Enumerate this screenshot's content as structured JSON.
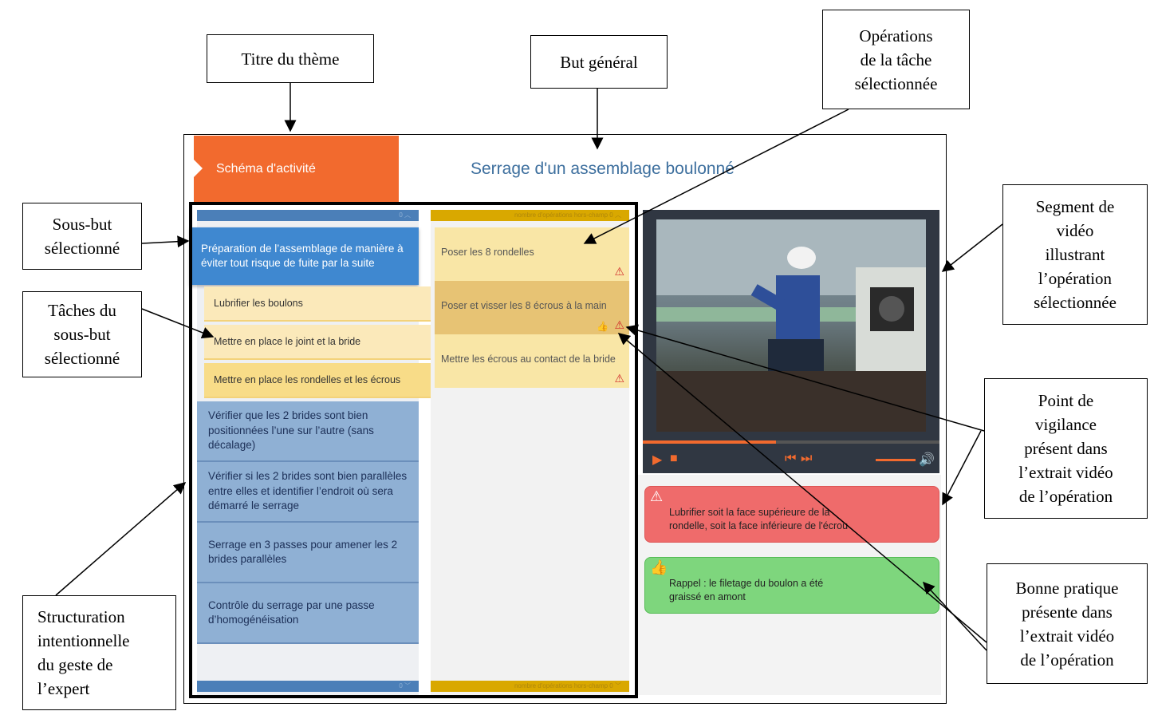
{
  "callouts": {
    "titre_theme": "Titre du thème",
    "but_general": "But général",
    "operations": [
      "Opérations",
      "de la tâche",
      "sélectionnée"
    ],
    "sous_but": [
      "Sous-but",
      "sélectionné"
    ],
    "taches": [
      "Tâches du",
      "sous-but",
      "sélectionné"
    ],
    "segment_video": [
      "Segment de",
      "vidéo",
      "illustrant",
      "l’opération",
      "sélectionnée"
    ],
    "point_vigilance": [
      "Point de",
      "vigilance",
      "présent dans",
      "l’extrait vidéo",
      "de l’opération"
    ],
    "bonne_pratique": [
      "Bonne pratique",
      "présente dans",
      "l’extrait vidéo",
      "de l’opération"
    ],
    "structuration": [
      "Structuration",
      "intentionnelle",
      "du geste de",
      "l’expert"
    ]
  },
  "app": {
    "tab_label": "Schéma d'activité",
    "page_title": "Serrage d'un assemblage boulonné",
    "col1_bar_top": "0",
    "col1_bar_bottom": "0",
    "col2_bar_top": "nombre d'opérations hors-champ  0",
    "col2_bar_bottom": "nombre d'opérations hors-champ  0",
    "subgoals": [
      "Préparation de l’assemblage de manière à éviter tout risque de fuite par la suite",
      "Vérifier que les 2 brides sont bien positionnées l’une sur l’autre (sans décalage)",
      "Vérifier si les 2 brides sont bien parallèles entre elles et identifier l’endroit où sera démarré le serrage",
      "Serrage en 3 passes pour amener les 2 brides parallèles",
      "Contrôle du serrage par une passe d’homogénéisation"
    ],
    "tasks": [
      "Lubrifier les boulons",
      "Mettre en place le joint et la bride",
      "Mettre en place les rondelles et les écrous"
    ],
    "operations": [
      "Poser les 8 rondelles",
      "Poser et visser les 8 écrous à la main",
      "Mettre les écrous au contact de la bride"
    ],
    "alert_red": [
      "Lubrifier soit la face supérieure de la",
      "rondelle, soit la face inférieure de l'écrou"
    ],
    "alert_green": [
      "Rappel : le filetage du boulon a été",
      "graissé en amont"
    ],
    "video_progress": 0.45
  },
  "colors": {
    "orange": "#f26a2e",
    "blue_selected": "#3f88d0",
    "blue_subgoal": "#8fb0d4",
    "red_alert": "#ef6b6b",
    "green_alert": "#7ed67d",
    "title_blue": "#3d6f9e"
  }
}
